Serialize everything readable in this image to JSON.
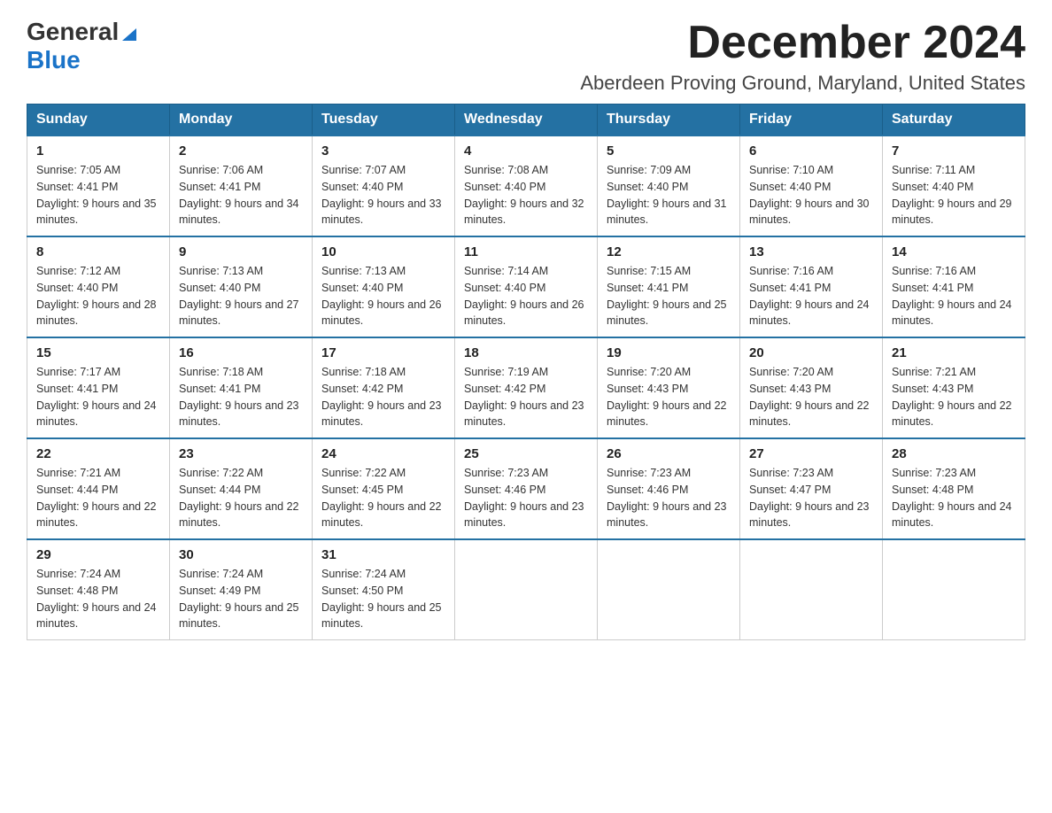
{
  "header": {
    "logo_general": "General",
    "logo_blue": "Blue",
    "month_title": "December 2024",
    "location": "Aberdeen Proving Ground, Maryland, United States"
  },
  "days_of_week": [
    "Sunday",
    "Monday",
    "Tuesday",
    "Wednesday",
    "Thursday",
    "Friday",
    "Saturday"
  ],
  "weeks": [
    {
      "days": [
        {
          "number": "1",
          "sunrise": "Sunrise: 7:05 AM",
          "sunset": "Sunset: 4:41 PM",
          "daylight": "Daylight: 9 hours and 35 minutes."
        },
        {
          "number": "2",
          "sunrise": "Sunrise: 7:06 AM",
          "sunset": "Sunset: 4:41 PM",
          "daylight": "Daylight: 9 hours and 34 minutes."
        },
        {
          "number": "3",
          "sunrise": "Sunrise: 7:07 AM",
          "sunset": "Sunset: 4:40 PM",
          "daylight": "Daylight: 9 hours and 33 minutes."
        },
        {
          "number": "4",
          "sunrise": "Sunrise: 7:08 AM",
          "sunset": "Sunset: 4:40 PM",
          "daylight": "Daylight: 9 hours and 32 minutes."
        },
        {
          "number": "5",
          "sunrise": "Sunrise: 7:09 AM",
          "sunset": "Sunset: 4:40 PM",
          "daylight": "Daylight: 9 hours and 31 minutes."
        },
        {
          "number": "6",
          "sunrise": "Sunrise: 7:10 AM",
          "sunset": "Sunset: 4:40 PM",
          "daylight": "Daylight: 9 hours and 30 minutes."
        },
        {
          "number": "7",
          "sunrise": "Sunrise: 7:11 AM",
          "sunset": "Sunset: 4:40 PM",
          "daylight": "Daylight: 9 hours and 29 minutes."
        }
      ]
    },
    {
      "days": [
        {
          "number": "8",
          "sunrise": "Sunrise: 7:12 AM",
          "sunset": "Sunset: 4:40 PM",
          "daylight": "Daylight: 9 hours and 28 minutes."
        },
        {
          "number": "9",
          "sunrise": "Sunrise: 7:13 AM",
          "sunset": "Sunset: 4:40 PM",
          "daylight": "Daylight: 9 hours and 27 minutes."
        },
        {
          "number": "10",
          "sunrise": "Sunrise: 7:13 AM",
          "sunset": "Sunset: 4:40 PM",
          "daylight": "Daylight: 9 hours and 26 minutes."
        },
        {
          "number": "11",
          "sunrise": "Sunrise: 7:14 AM",
          "sunset": "Sunset: 4:40 PM",
          "daylight": "Daylight: 9 hours and 26 minutes."
        },
        {
          "number": "12",
          "sunrise": "Sunrise: 7:15 AM",
          "sunset": "Sunset: 4:41 PM",
          "daylight": "Daylight: 9 hours and 25 minutes."
        },
        {
          "number": "13",
          "sunrise": "Sunrise: 7:16 AM",
          "sunset": "Sunset: 4:41 PM",
          "daylight": "Daylight: 9 hours and 24 minutes."
        },
        {
          "number": "14",
          "sunrise": "Sunrise: 7:16 AM",
          "sunset": "Sunset: 4:41 PM",
          "daylight": "Daylight: 9 hours and 24 minutes."
        }
      ]
    },
    {
      "days": [
        {
          "number": "15",
          "sunrise": "Sunrise: 7:17 AM",
          "sunset": "Sunset: 4:41 PM",
          "daylight": "Daylight: 9 hours and 24 minutes."
        },
        {
          "number": "16",
          "sunrise": "Sunrise: 7:18 AM",
          "sunset": "Sunset: 4:41 PM",
          "daylight": "Daylight: 9 hours and 23 minutes."
        },
        {
          "number": "17",
          "sunrise": "Sunrise: 7:18 AM",
          "sunset": "Sunset: 4:42 PM",
          "daylight": "Daylight: 9 hours and 23 minutes."
        },
        {
          "number": "18",
          "sunrise": "Sunrise: 7:19 AM",
          "sunset": "Sunset: 4:42 PM",
          "daylight": "Daylight: 9 hours and 23 minutes."
        },
        {
          "number": "19",
          "sunrise": "Sunrise: 7:20 AM",
          "sunset": "Sunset: 4:43 PM",
          "daylight": "Daylight: 9 hours and 22 minutes."
        },
        {
          "number": "20",
          "sunrise": "Sunrise: 7:20 AM",
          "sunset": "Sunset: 4:43 PM",
          "daylight": "Daylight: 9 hours and 22 minutes."
        },
        {
          "number": "21",
          "sunrise": "Sunrise: 7:21 AM",
          "sunset": "Sunset: 4:43 PM",
          "daylight": "Daylight: 9 hours and 22 minutes."
        }
      ]
    },
    {
      "days": [
        {
          "number": "22",
          "sunrise": "Sunrise: 7:21 AM",
          "sunset": "Sunset: 4:44 PM",
          "daylight": "Daylight: 9 hours and 22 minutes."
        },
        {
          "number": "23",
          "sunrise": "Sunrise: 7:22 AM",
          "sunset": "Sunset: 4:44 PM",
          "daylight": "Daylight: 9 hours and 22 minutes."
        },
        {
          "number": "24",
          "sunrise": "Sunrise: 7:22 AM",
          "sunset": "Sunset: 4:45 PM",
          "daylight": "Daylight: 9 hours and 22 minutes."
        },
        {
          "number": "25",
          "sunrise": "Sunrise: 7:23 AM",
          "sunset": "Sunset: 4:46 PM",
          "daylight": "Daylight: 9 hours and 23 minutes."
        },
        {
          "number": "26",
          "sunrise": "Sunrise: 7:23 AM",
          "sunset": "Sunset: 4:46 PM",
          "daylight": "Daylight: 9 hours and 23 minutes."
        },
        {
          "number": "27",
          "sunrise": "Sunrise: 7:23 AM",
          "sunset": "Sunset: 4:47 PM",
          "daylight": "Daylight: 9 hours and 23 minutes."
        },
        {
          "number": "28",
          "sunrise": "Sunrise: 7:23 AM",
          "sunset": "Sunset: 4:48 PM",
          "daylight": "Daylight: 9 hours and 24 minutes."
        }
      ]
    },
    {
      "days": [
        {
          "number": "29",
          "sunrise": "Sunrise: 7:24 AM",
          "sunset": "Sunset: 4:48 PM",
          "daylight": "Daylight: 9 hours and 24 minutes."
        },
        {
          "number": "30",
          "sunrise": "Sunrise: 7:24 AM",
          "sunset": "Sunset: 4:49 PM",
          "daylight": "Daylight: 9 hours and 25 minutes."
        },
        {
          "number": "31",
          "sunrise": "Sunrise: 7:24 AM",
          "sunset": "Sunset: 4:50 PM",
          "daylight": "Daylight: 9 hours and 25 minutes."
        },
        null,
        null,
        null,
        null
      ]
    }
  ]
}
